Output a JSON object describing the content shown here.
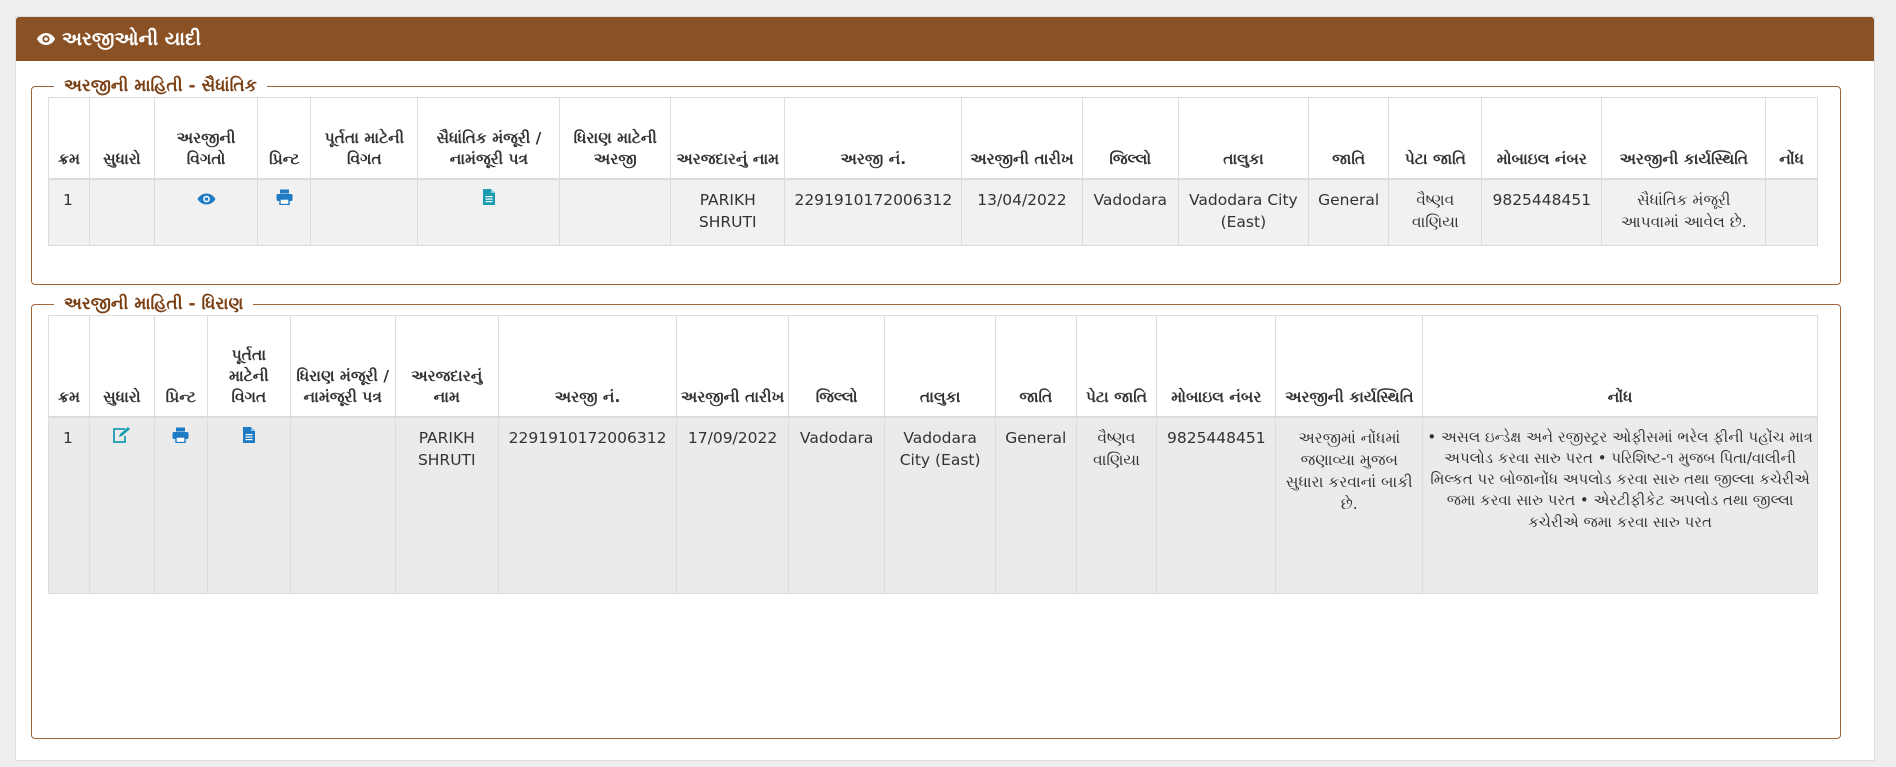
{
  "header": {
    "title": "અરજીઓની યાદી",
    "icon": "eye-icon"
  },
  "colors": {
    "header_bg": "#8a5125",
    "legend_text": "#7b3f14",
    "icon_blue": "#1e7bc4",
    "icon_teal": "#1a9cb0"
  },
  "section1": {
    "legend": "અરજીની માહિતી - સૈધાંતિક",
    "columns": [
      "ક્રમ",
      "સુધારો",
      "અરજીની વિગતો",
      "પ્રિન્ટ",
      "પૂર્તતા માટેની વિગત",
      "સૈધાંતિક મંજૂરી / નામંજૂરી પત્ર",
      "ધિરાણ માટેની અરજી",
      "અરજદારનું નામ",
      "અરજી નં.",
      "અરજીની તારીખ",
      "જિલ્લો",
      "તાલુકા",
      "જાતિ",
      "પેટા જાતિ",
      "મોબાઇલ નંબર",
      "અરજીની કાર્યસ્થિતિ",
      "નોંધ"
    ],
    "rows": [
      {
        "sr": "1",
        "name": "PARIKH SHRUTI",
        "application_no": "2291910172006312",
        "date": "13/04/2022",
        "district": "Vadodara",
        "taluka": "Vadodara City (East)",
        "caste": "General",
        "sub_caste": "વૈષ્ણવ વાણિયા",
        "mobile": "9825448451",
        "status": "સૈધાંતિક મંજૂરી આપવામાં આવેલ છે.",
        "note": ""
      }
    ]
  },
  "section2": {
    "legend": "અરજીની માહિતી - ધિરાણ",
    "columns": [
      "ક્રમ",
      "સુધારો",
      "પ્રિન્ટ",
      "પૂર્તતા માટેની વિગત",
      "ધિરાણ મંજૂરી / નામંજૂરી પત્ર",
      "અરજદારનું નામ",
      "અરજી નં.",
      "અરજીની તારીખ",
      "જિલ્લો",
      "તાલુકા",
      "જાતિ",
      "પેટા જાતિ",
      "મોબાઇલ નંબર",
      "અરજીની કાર્યસ્થિતિ",
      "નોંધ"
    ],
    "rows": [
      {
        "sr": "1",
        "name": "PARIKH SHRUTI",
        "application_no": "2291910172006312",
        "date": "17/09/2022",
        "district": "Vadodara",
        "taluka": "Vadodara City (East)",
        "caste": "General",
        "sub_caste": "વૈષ્ણવ વાણિયા",
        "mobile": "9825448451",
        "status": "અરજીમાં નોંધમાં જણાવ્યા મુજબ સુધારા કરવાનાં બાકી છે.",
        "note": "• અસલ ઇન્ડેક્ષ અને રજીસ્ટ્રર ઓફીસમાં ભરેલ ફીની પહોંચ માત્ર અપલોડ કરવા સારુ પરત • પરિશિષ્ટ-૧ મુજબ પિતા/વાલીની મિલ્કત પર બોજાનોંધ અપલોડ કરવા સારુ તથા જીલ્લા કચેરીએ જમા કરવા સારુ પરત • એરટીફીકેટ અપલોડ તથા જીલ્લા કચેરીએ જમા કરવા સારુ પરત"
      }
    ]
  }
}
